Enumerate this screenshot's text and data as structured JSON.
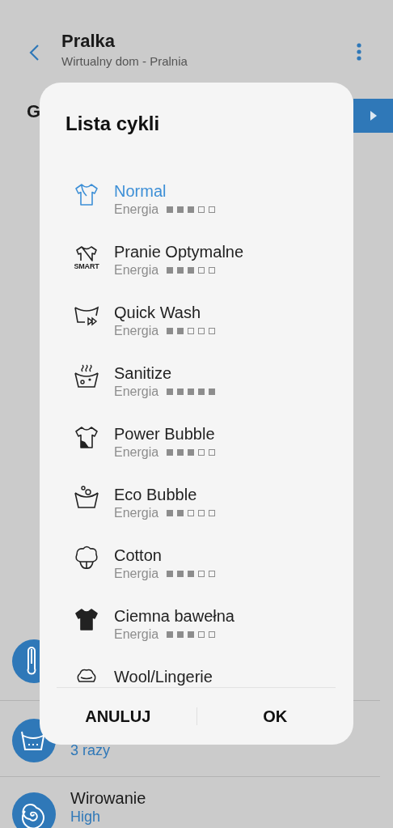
{
  "header": {
    "title": "Pralka",
    "subtitle": "Wirtualny dom - Pralnia"
  },
  "section": {
    "heading": "G"
  },
  "settings": [
    {
      "value": "3 razy"
    },
    {
      "title": "Wirowanie",
      "value": "High"
    }
  ],
  "dialog": {
    "title": "Lista cykli",
    "cycles": [
      {
        "name": "Normal",
        "energy_label": "Energia",
        "stars": 3,
        "selected": true
      },
      {
        "name": "Pranie Optymalne",
        "icon_label": "SMART",
        "energy_label": "Energia",
        "stars": 3,
        "selected": false
      },
      {
        "name": "Quick Wash",
        "energy_label": "Energia",
        "stars": 2,
        "selected": false
      },
      {
        "name": "Sanitize",
        "energy_label": "Energia",
        "stars": 5,
        "selected": false
      },
      {
        "name": "Power Bubble",
        "energy_label": "Energia",
        "stars": 3,
        "selected": false
      },
      {
        "name": "Eco Bubble",
        "energy_label": "Energia",
        "stars": 2,
        "selected": false
      },
      {
        "name": "Cotton",
        "energy_label": "Energia",
        "stars": 3,
        "selected": false
      },
      {
        "name": "Ciemna bawełna",
        "energy_label": "Energia",
        "stars": 3,
        "selected": false
      },
      {
        "name": "Wool/Lingerie",
        "selected": false
      }
    ],
    "buttons": [
      "ANULUJ",
      "OK"
    ]
  }
}
